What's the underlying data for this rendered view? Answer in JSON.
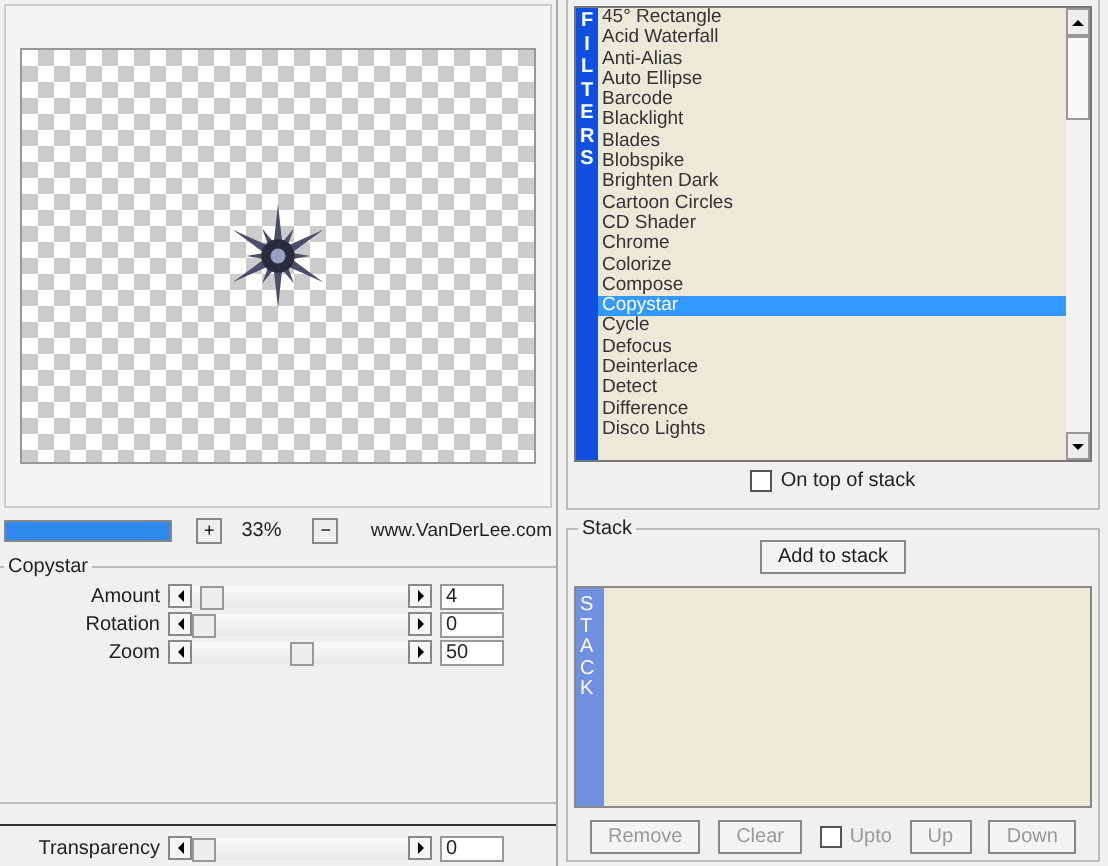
{
  "progress": {
    "level": 1
  },
  "zoom": {
    "plus": "+",
    "value": "33%",
    "minus": "−",
    "link": "www.VanDerLee.com"
  },
  "effect": {
    "title": "Copystar",
    "sliders": [
      {
        "label": "Amount",
        "level": 0.04,
        "value": "4"
      },
      {
        "label": "Rotation",
        "level": 0,
        "value": "0"
      },
      {
        "label": "Zoom",
        "level": 0.5,
        "value": "50"
      }
    ]
  },
  "transparency": {
    "label": "Transparency",
    "level": 0,
    "value": "0"
  },
  "filters": {
    "strip": "FILTERS",
    "items": [
      {
        "label": "45° Rectangle",
        "selected": false
      },
      {
        "label": "Acid Waterfall",
        "selected": false
      },
      {
        "label": "Anti-Alias",
        "selected": false
      },
      {
        "label": "Auto Ellipse",
        "selected": false
      },
      {
        "label": "Barcode",
        "selected": false
      },
      {
        "label": "Blacklight",
        "selected": false
      },
      {
        "label": "Blades",
        "selected": false
      },
      {
        "label": "Blobspike",
        "selected": false
      },
      {
        "label": "Brighten Dark",
        "selected": false
      },
      {
        "label": "Cartoon Circles",
        "selected": false
      },
      {
        "label": "CD Shader",
        "selected": false
      },
      {
        "label": "Chrome",
        "selected": false
      },
      {
        "label": "Colorize",
        "selected": false
      },
      {
        "label": "Compose",
        "selected": false
      },
      {
        "label": "Copystar",
        "selected": true
      },
      {
        "label": "Cycle",
        "selected": false
      },
      {
        "label": "Defocus",
        "selected": false
      },
      {
        "label": "Deinterlace",
        "selected": false
      },
      {
        "label": "Detect",
        "selected": false
      },
      {
        "label": "Difference",
        "selected": false
      },
      {
        "label": "Disco Lights",
        "selected": false
      }
    ],
    "on_top": {
      "label": "On top of stack",
      "checked": false
    }
  },
  "stack": {
    "title": "Stack",
    "add": "Add to stack",
    "strip": "STACK",
    "buttons": [
      {
        "label": "Remove",
        "disabled": true
      },
      {
        "label": "Clear",
        "disabled": true
      }
    ],
    "upto": {
      "label": "Upto",
      "checked": false,
      "disabled": true
    },
    "buttons2": [
      {
        "label": "Up",
        "disabled": true
      },
      {
        "label": "Down",
        "disabled": true
      }
    ]
  }
}
